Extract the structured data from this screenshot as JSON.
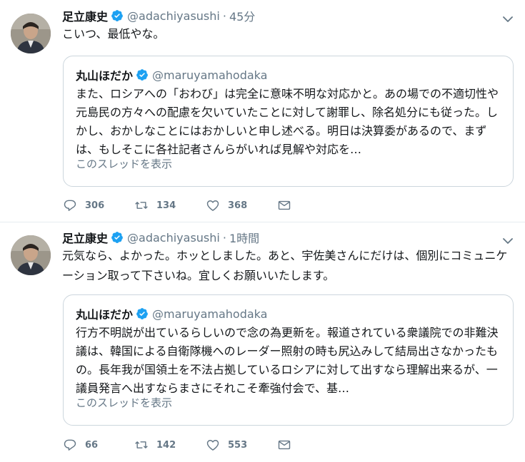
{
  "colors": {
    "verified": "#1da1f2",
    "muted": "#657786",
    "border": "#ccd6dd",
    "text": "#14171a"
  },
  "tweets": [
    {
      "name": "足立康史",
      "handle": "@adachiyasushi",
      "separator": "·",
      "time": "45分",
      "text": "こいつ、最低やな。",
      "quote": {
        "name": "丸山ほだか",
        "handle": "@maruyamahodaka",
        "text": "また、ロシアへの「おわび」は完全に意味不明な対応かと。あの場での不適切性や元島民の方々への配慮を欠いていたことに対して謝罪し、除名処分にも従った。しかし、おかしなことにはおかしいと申し述べる。明日は決算委があるので、まずは、もしそこに各社記者さんらがいれば見解や対応を…",
        "thread_link": "このスレッドを表示"
      },
      "replies": "306",
      "retweets": "134",
      "likes": "368"
    },
    {
      "name": "足立康史",
      "handle": "@adachiyasushi",
      "separator": "·",
      "time": "1時間",
      "text": "元気なら、よかった。ホッとしました。あと、宇佐美さんにだけは、個別にコミュニケーション取って下さいね。宜しくお願いいたします。",
      "quote": {
        "name": "丸山ほだか",
        "handle": "@maruyamahodaka",
        "text": "行方不明説が出ているらしいので念の為更新を。報道されている衆議院での非難決議は、韓国による自衛隊機へのレーダー照射の時も尻込みして結局出さなかったもの。長年我が国領土を不法占拠しているロシアに対して出すなら理解出来るが、一議員発言へ出すならまさにそれこそ牽強付会で、基…",
        "thread_link": "このスレッドを表示"
      },
      "replies": "66",
      "retweets": "142",
      "likes": "553"
    }
  ]
}
